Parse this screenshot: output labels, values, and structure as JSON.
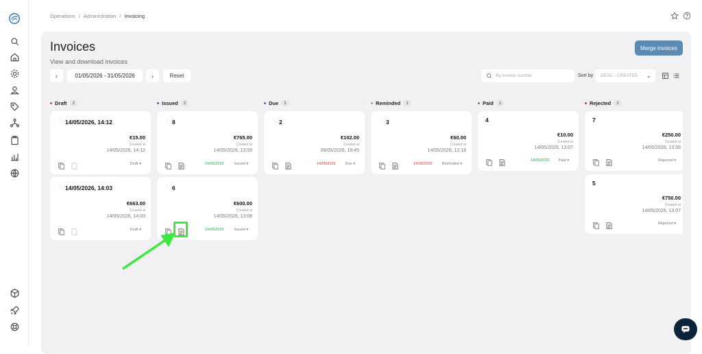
{
  "breadcrumb": {
    "items": [
      "Operations",
      "Administration",
      "Invoicing"
    ],
    "sep": "/"
  },
  "page": {
    "title": "Invoices",
    "subtitle": "View and download invoices"
  },
  "toolbar": {
    "prev_label": "‹",
    "next_label": "›",
    "date_range": "01/05/2026 - 31/05/2026",
    "reset_label": "Reset",
    "search_placeholder": "By invoice number",
    "sort_label": "Sort by",
    "sort_value": "DESC - CREATED",
    "merge_label": "Merge invoices"
  },
  "columns": [
    {
      "name": "Draft",
      "count": "2",
      "dot_color": "#e0463b"
    },
    {
      "name": "Issued",
      "count": "2",
      "dot_color": "#3d5fc9"
    },
    {
      "name": "Due",
      "count": "1",
      "dot_color": "#8a3fc9"
    },
    {
      "name": "Reminded",
      "count": "1",
      "dot_color": "#e8873a"
    },
    {
      "name": "Paid",
      "count": "1",
      "dot_color": "#2aa84a"
    },
    {
      "name": "Rejected",
      "count": "2",
      "dot_color": "#d13434"
    }
  ],
  "cards": [
    {
      "title": "14/05/2026, 14:12",
      "amount": "€15.00",
      "created_label": "Created at",
      "created": "14/05/2026, 14:12",
      "date": "",
      "status": "Draft ▾"
    },
    {
      "title": "14/05/2026, 14:03",
      "amount": "€663.00",
      "created_label": "Created at",
      "created": "14/05/2026, 14:03",
      "date": "",
      "status": "Draft ▾"
    },
    {
      "title": "8",
      "amount": "€765.00",
      "created_label": "Created at",
      "created": "14/05/2026, 13:59",
      "date": "14/05/2026",
      "status": "Issued ▾"
    },
    {
      "title": "6",
      "amount": "€600.00",
      "created_label": "Created at",
      "created": "14/05/2026, 13:08",
      "date": "14/05/2026",
      "status": "Issued ▾"
    },
    {
      "title": "2",
      "amount": "€102.00",
      "created_label": "Created at",
      "created": "06/05/2026, 16:45",
      "date": "14/05/2026",
      "status": "Due ▾"
    },
    {
      "title": "3",
      "amount": "€60.00",
      "created_label": "Created at",
      "created": "14/05/2026, 12:18",
      "date": "14/05/2026",
      "status": "Reminded ▾"
    },
    {
      "title": "4",
      "amount": "€10.00",
      "created_label": "Created at",
      "created": "14/05/2026, 13:07",
      "date": "14/05/2026",
      "status": "Paid ▾"
    },
    {
      "title": "7",
      "amount": "€250.00",
      "created_label": "Created at",
      "created": "14/05/2026, 13:58",
      "date": "",
      "status": "Rejected ▾"
    },
    {
      "title": "5",
      "amount": "€750.00",
      "created_label": "Created at",
      "created": "14/05/2026, 13:07",
      "date": "",
      "status": "Rejected ▾"
    }
  ],
  "colors": {
    "accent": "#5a8bb5",
    "annotation": "#3ee83e",
    "green": "#2aa84a",
    "red": "#d13434",
    "chat": "#0d2339"
  }
}
